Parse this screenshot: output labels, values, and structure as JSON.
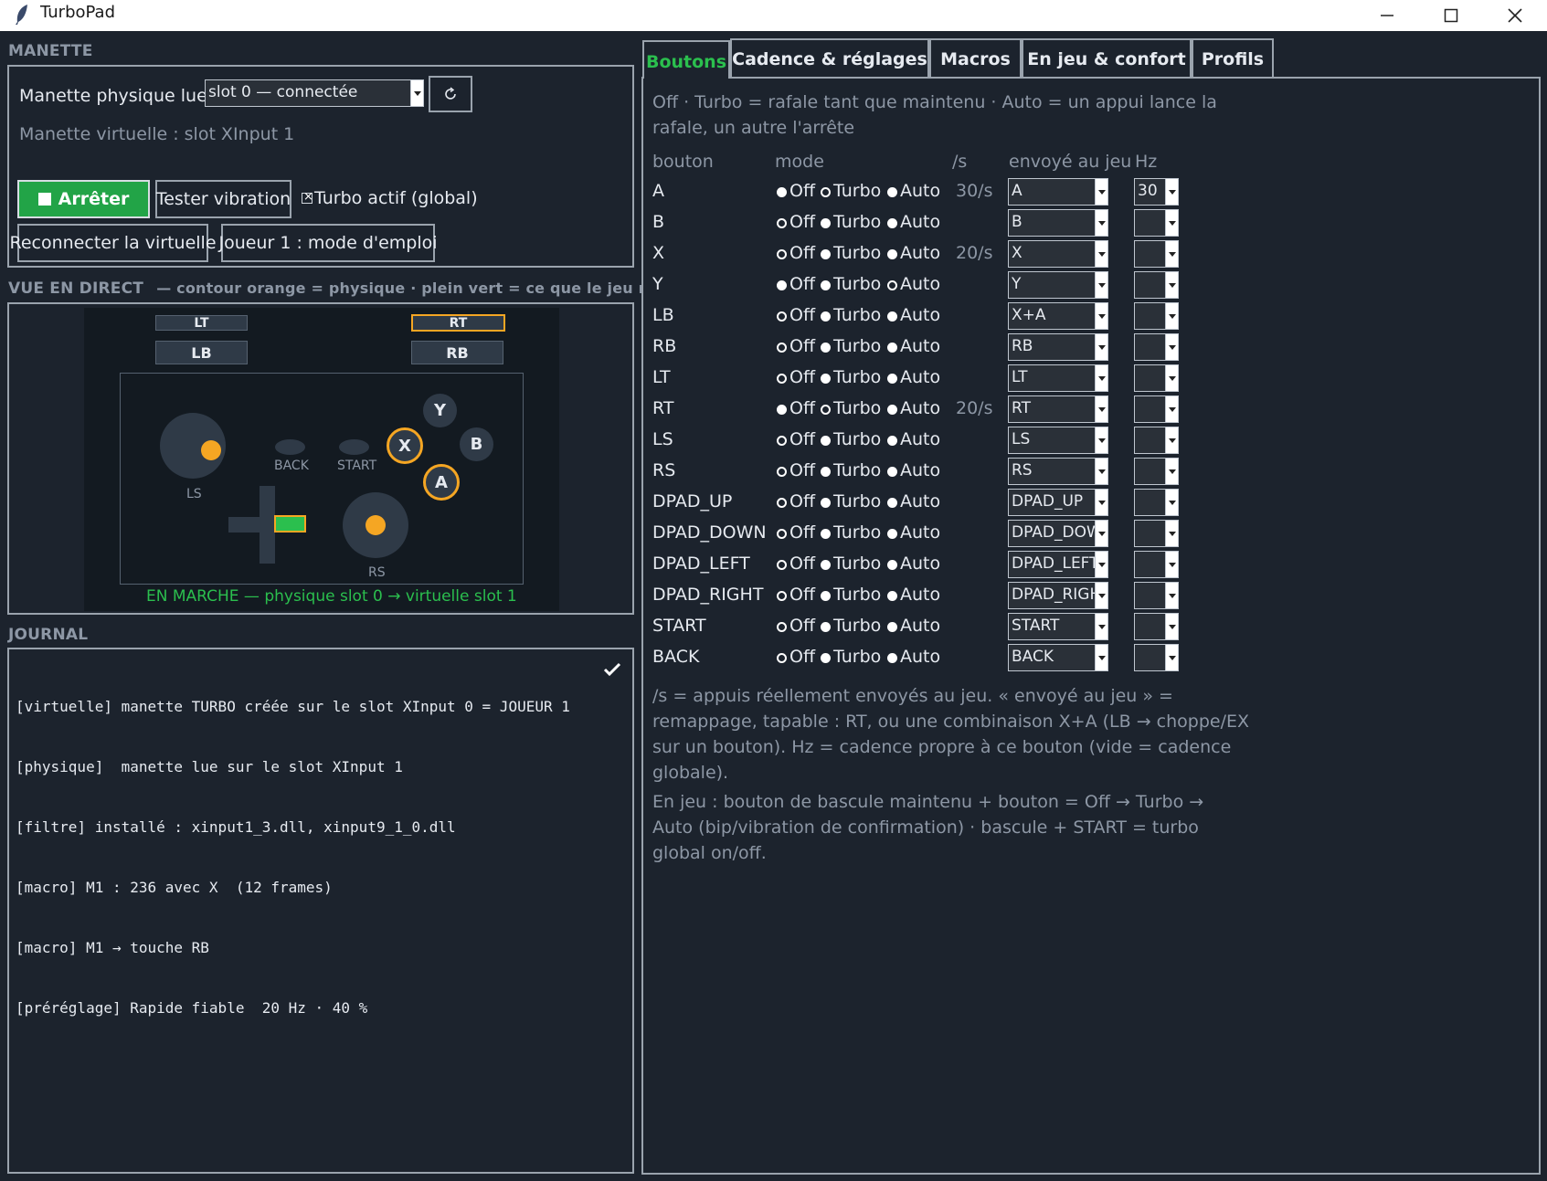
{
  "window": {
    "title": "TurboPad"
  },
  "manette": {
    "section_label": "MANETTE",
    "physical_label": "Manette physique lue :",
    "physical_value": "slot 0 — connectée",
    "virtual_info": "Manette virtuelle : slot XInput 1",
    "stop_label": "Arrêter",
    "vibrate_label": "Tester vibration",
    "turbo_global_label": "Turbo actif (global)",
    "reconnect_label": "Reconnecter la virtuelle",
    "help_label": "Joueur 1 : mode d'emploi"
  },
  "live_view": {
    "label": "VUE EN DIRECT",
    "legend": "—  contour orange = physique · plein vert = ce que le jeu reçoit",
    "lt": "LT",
    "rt": "RT",
    "lb": "LB",
    "rb": "RB",
    "ls": "LS",
    "rs": "RS",
    "back": "BACK",
    "start": "START",
    "y": "Y",
    "x": "X",
    "b": "B",
    "a": "A",
    "status": "EN MARCHE — physique slot 0 → virtuelle slot 1"
  },
  "journal": {
    "label": "JOURNAL",
    "lines": [
      "[virtuelle] manette TURBO créée sur le slot XInput 0 = JOUEUR 1",
      "[physique]  manette lue sur le slot XInput 1",
      "[filtre] installé : xinput1_3.dll, xinput9_1_0.dll",
      "[macro] M1 : 236 avec X  (12 frames)",
      "[macro] M1 → touche RB",
      "[préréglage] Rapide fiable  20 Hz · 40 %"
    ]
  },
  "tabs": [
    "Boutons",
    "Cadence & réglages",
    "Macros",
    "En jeu & confort",
    "Profils"
  ],
  "boutons": {
    "intro_1": "Off · Turbo = rafale tant que maintenu · Auto = un appui lance la",
    "intro_2": "rafale, un autre l'arrête",
    "headers": {
      "button": "bouton",
      "mode": "mode",
      "rate": "/s",
      "sent": "envoyé au jeu",
      "hz": "Hz"
    },
    "mode_off": "Off",
    "mode_turbo": "Turbo",
    "mode_auto": "Auto",
    "rows": [
      {
        "name": "A",
        "mode": "Turbo",
        "rate": "30/s",
        "sent": "A",
        "hz": "30"
      },
      {
        "name": "B",
        "mode": "Off",
        "rate": "",
        "sent": "B",
        "hz": ""
      },
      {
        "name": "X",
        "mode": "Off",
        "rate": "20/s",
        "sent": "X",
        "hz": ""
      },
      {
        "name": "Y",
        "mode": "Auto",
        "rate": "",
        "sent": "Y",
        "hz": ""
      },
      {
        "name": "LB",
        "mode": "Off",
        "rate": "",
        "sent": "X+A",
        "hz": ""
      },
      {
        "name": "RB",
        "mode": "Off",
        "rate": "",
        "sent": "RB",
        "hz": ""
      },
      {
        "name": "LT",
        "mode": "Off",
        "rate": "",
        "sent": "LT",
        "hz": ""
      },
      {
        "name": "RT",
        "mode": "Turbo",
        "rate": "20/s",
        "sent": "RT",
        "hz": ""
      },
      {
        "name": "LS",
        "mode": "Off",
        "rate": "",
        "sent": "LS",
        "hz": ""
      },
      {
        "name": "RS",
        "mode": "Off",
        "rate": "",
        "sent": "RS",
        "hz": ""
      },
      {
        "name": "DPAD_UP",
        "mode": "Off",
        "rate": "",
        "sent": "DPAD_UP",
        "hz": ""
      },
      {
        "name": "DPAD_DOWN",
        "mode": "Off",
        "rate": "",
        "sent": "DPAD_DOW",
        "hz": ""
      },
      {
        "name": "DPAD_LEFT",
        "mode": "Off",
        "rate": "",
        "sent": "DPAD_LEFT",
        "hz": ""
      },
      {
        "name": "DPAD_RIGHT",
        "mode": "Off",
        "rate": "",
        "sent": "DPAD_RIGH",
        "hz": ""
      },
      {
        "name": "START",
        "mode": "Off",
        "rate": "",
        "sent": "START",
        "hz": ""
      },
      {
        "name": "BACK",
        "mode": "Off",
        "rate": "",
        "sent": "BACK",
        "hz": ""
      }
    ],
    "note1": [
      "/s = appuis réellement envoyés au jeu. « envoyé au jeu » =",
      "remappage, tapable : RT, ou une combinaison X+A (LB → choppe/EX",
      "sur un bouton). Hz = cadence propre à ce bouton (vide = cadence",
      "globale)."
    ],
    "note2": [
      "En jeu : bouton de bascule maintenu + bouton = Off → Turbo →",
      "Auto (bip/vibration de confirmation) · bascule + START = turbo",
      "global on/off."
    ]
  }
}
